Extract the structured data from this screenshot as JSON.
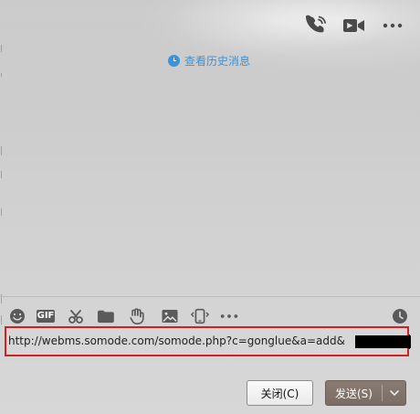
{
  "topbar": {
    "call_icon": "phone-icon",
    "video_icon": "video-icon",
    "more_icon": "more-icon"
  },
  "history": {
    "label": "查看历史消息",
    "icon": "clock-icon"
  },
  "toolbar": {
    "icons": [
      "emoji-icon",
      "gif-icon",
      "scissors-icon",
      "folder-icon",
      "hand-icon",
      "image-icon",
      "phone-shake-icon",
      "ellipsis-icon",
      "clock-icon"
    ],
    "gif_label": "GIF"
  },
  "editor": {
    "text": "http://webms.somode.com/somode.php?c=gonglue&a=add&"
  },
  "buttons": {
    "close_label": "关闭(C)",
    "send_label": "发送(S)"
  },
  "colors": {
    "accent": "#3b93d8",
    "highlight": "#d21f1f",
    "send_button": "#7f726a"
  }
}
